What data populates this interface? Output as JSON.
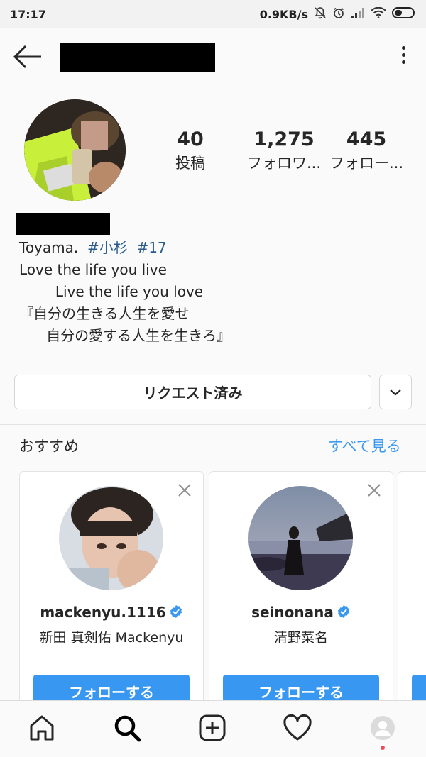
{
  "status_bar": {
    "time": "17:17",
    "net_speed": "0.9KB/s"
  },
  "profile": {
    "stats": [
      {
        "value": "40",
        "label": "投稿"
      },
      {
        "value": "1,275",
        "label": "フォロワ..."
      },
      {
        "value": "445",
        "label": "フォロー..."
      }
    ],
    "bio": {
      "line1_text": "Toyama.  ",
      "line1_tag1": "#小杉",
      "line1_sep": "  ",
      "line1_tag2": "#17",
      "line2": "Love the life you live",
      "line3": "        Live the life you love",
      "line4": "『自分の生きる人生を愛せ",
      "line5": "      自分の愛する人生を生きろ』"
    }
  },
  "actions": {
    "request_label": "リクエスト済み"
  },
  "suggestions": {
    "title": "おすすめ",
    "see_all": "すべて見る",
    "cards": [
      {
        "username": "mackenyu.1116",
        "full_name": "新田 真剣佑 Mackenyu",
        "follow_label": "フォローする"
      },
      {
        "username": "seinonana",
        "full_name": "清野菜名",
        "follow_label": "フォローする"
      }
    ]
  },
  "colors": {
    "accent": "#3897f0",
    "verified": "#3897f0",
    "hashtag": "#2a5a8a",
    "notification_dot": "#ed4956"
  },
  "icons": {
    "nav": [
      "home-icon",
      "search-icon",
      "add-post-icon",
      "heart-icon",
      "profile-avatar-icon"
    ]
  }
}
